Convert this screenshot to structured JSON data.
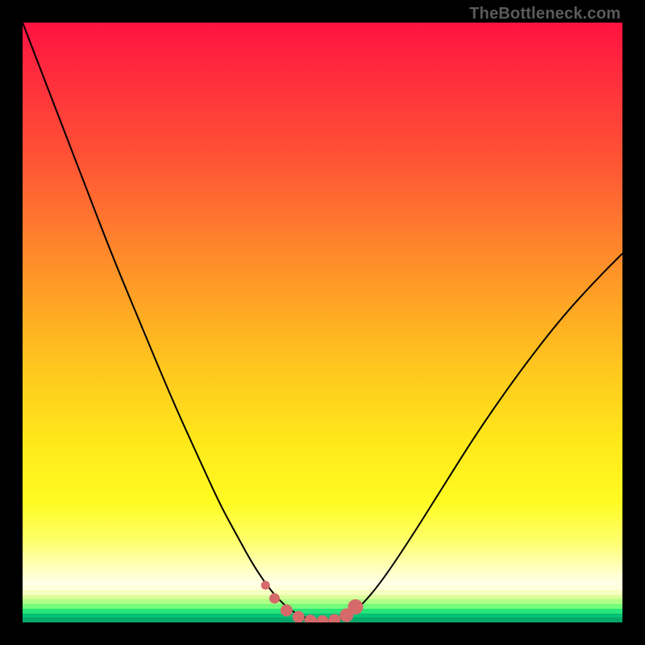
{
  "attribution": "TheBottleneck.com",
  "colors": {
    "page_bg": "#000000",
    "curve": "#000000",
    "marker_fill": "#d66a6a",
    "marker_stroke": "#d66a6a",
    "bottom_strips": [
      "#ffffdc",
      "#f6ffc0",
      "#dcff9e",
      "#b0ff86",
      "#74fd7a",
      "#28e57a",
      "#05c176",
      "#02a869"
    ]
  },
  "chart_data": {
    "type": "line",
    "title": "",
    "xlabel": "",
    "ylabel": "",
    "xlim": [
      0,
      1
    ],
    "ylim": [
      0,
      1
    ],
    "series": [
      {
        "name": "bottleneck-curve",
        "x": [
          0.0,
          0.05,
          0.1,
          0.15,
          0.2,
          0.25,
          0.3,
          0.33,
          0.36,
          0.385,
          0.41,
          0.43,
          0.45,
          0.47,
          0.49,
          0.505,
          0.52,
          0.54,
          0.565,
          0.6,
          0.65,
          0.7,
          0.76,
          0.83,
          0.9,
          0.96,
          1.0
        ],
        "y": [
          1.0,
          0.87,
          0.74,
          0.61,
          0.49,
          0.37,
          0.26,
          0.195,
          0.14,
          0.095,
          0.058,
          0.035,
          0.018,
          0.008,
          0.003,
          0.002,
          0.003,
          0.01,
          0.028,
          0.07,
          0.145,
          0.225,
          0.32,
          0.42,
          0.51,
          0.575,
          0.615
        ]
      }
    ],
    "markers": {
      "name": "trough-markers",
      "x": [
        0.405,
        0.42,
        0.44,
        0.46,
        0.48,
        0.5,
        0.52,
        0.54,
        0.555
      ],
      "y": [
        0.062,
        0.04,
        0.02,
        0.009,
        0.003,
        0.002,
        0.004,
        0.012,
        0.026
      ],
      "r": [
        5,
        6,
        7,
        7,
        7,
        7,
        7,
        8,
        9
      ]
    }
  }
}
